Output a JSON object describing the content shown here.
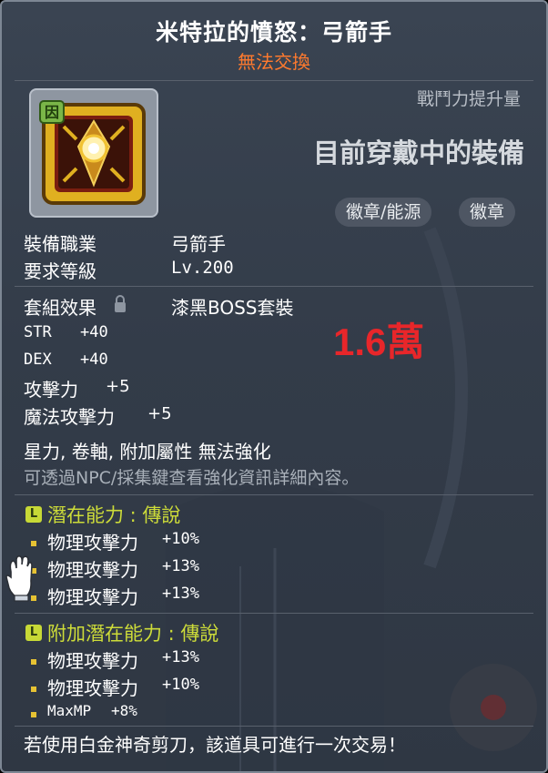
{
  "item": {
    "title": "米特拉的憤怒：弓箭手",
    "trade_status": "無法交換",
    "combat_power_label": "戰鬥力提升量",
    "equipped_label": "目前穿戴中的裝備",
    "tags": [
      "徽章/能源",
      "徽章"
    ],
    "job_label": "裝備職業",
    "job_value": "弓箭手",
    "level_label": "要求等級",
    "level_value": "Lv.200",
    "set_label": "套組效果",
    "set_value": "漆黑BOSS套裝",
    "price_overlay": "1.6萬",
    "stats": [
      {
        "name": "STR",
        "value": "+40"
      },
      {
        "name": "DEX",
        "value": "+40"
      },
      {
        "name": "攻擊力",
        "value": "+5"
      },
      {
        "name": "魔法攻擊力",
        "value": "+5"
      }
    ],
    "enhance_note": "星力, 卷軸, 附加屬性 無法強化",
    "npc_note": "可透過NPC/採集鍵查看強化資訊詳細內容。"
  },
  "potential": {
    "badge": "L",
    "title": "潛在能力 : 傳說",
    "lines": [
      {
        "name": "物理攻擊力",
        "value": "+10%"
      },
      {
        "name": "物理攻擊力",
        "value": "+13%"
      },
      {
        "name": "物理攻擊力",
        "value": "+13%"
      }
    ]
  },
  "bonus_potential": {
    "badge": "L",
    "title": "附加潛在能力 : 傳說",
    "lines": [
      {
        "name": "物理攻擊力",
        "value": "+13%"
      },
      {
        "name": "物理攻擊力",
        "value": "+10%"
      },
      {
        "name": "MaxMP",
        "value": "+8%"
      }
    ]
  },
  "footer": "若使用白金神奇剪刀，該道具可進行一次交易！",
  "colors": {
    "background": "#333c49",
    "trade_status": "#ff7a2e",
    "price_overlay": "#e8262a",
    "potential_title": "#cddc39",
    "bullet": "#e6c233"
  },
  "icons": [
    "emblem-item-icon",
    "lock-icon",
    "potential-rank-badge",
    "glove-cursor-icon"
  ]
}
